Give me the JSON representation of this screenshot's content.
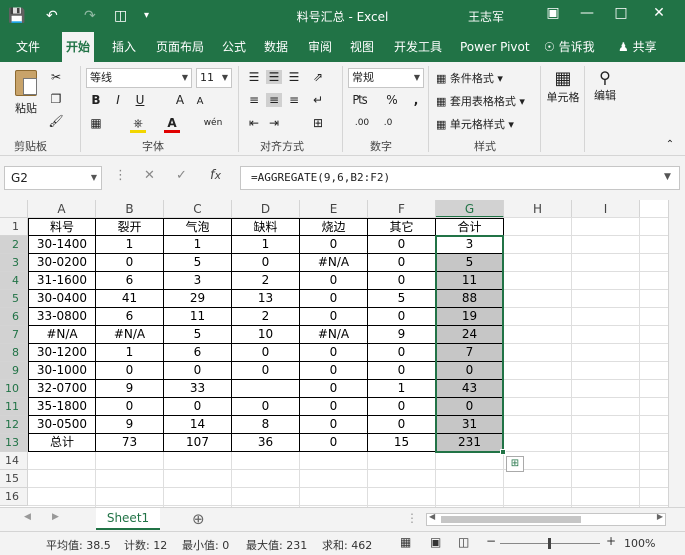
{
  "window": {
    "title": "料号汇总 - Excel",
    "user": "王志军"
  },
  "menu": {
    "tabs": [
      "文件",
      "开始",
      "插入",
      "页面布局",
      "公式",
      "数据",
      "审阅",
      "视图",
      "开发工具",
      "Power Pivot"
    ],
    "tell_me": "告诉我",
    "share": "共享"
  },
  "ribbon": {
    "clipboard": {
      "paste": "粘贴",
      "label": "剪贴板"
    },
    "font": {
      "name": "等线",
      "size": "11",
      "bold": "B",
      "italic": "I",
      "underline": "U",
      "grow": "A",
      "shrink": "A",
      "wen": "wén",
      "label": "字体"
    },
    "alignment": {
      "label": "对齐方式"
    },
    "number": {
      "format": "常规",
      "percent": "%",
      "comma": ",",
      "label": "数字"
    },
    "styles": {
      "conditional": "条件格式",
      "table": "套用表格格式",
      "cell": "单元格样式",
      "label": "样式"
    },
    "cells": {
      "label": "单元格"
    },
    "editing": {
      "label": "编辑"
    }
  },
  "formula_bar": {
    "name_box": "G2",
    "formula": "=AGGREGATE(9,6,B2:F2)"
  },
  "columns": [
    "A",
    "B",
    "C",
    "D",
    "E",
    "F",
    "G",
    "H",
    "I"
  ],
  "rows": [
    [
      "料号",
      "裂开",
      "气泡",
      "缺料",
      "烧边",
      "其它",
      "合计"
    ],
    [
      "30-1400",
      "1",
      "1",
      "1",
      "0",
      "0",
      "3"
    ],
    [
      "30-0200",
      "0",
      "5",
      "0",
      "#N/A",
      "0",
      "5"
    ],
    [
      "31-1600",
      "6",
      "3",
      "2",
      "0",
      "0",
      "11"
    ],
    [
      "30-0400",
      "41",
      "29",
      "13",
      "0",
      "5",
      "88"
    ],
    [
      "33-0800",
      "6",
      "11",
      "2",
      "0",
      "0",
      "19"
    ],
    [
      "#N/A",
      "#N/A",
      "5",
      "10",
      "#N/A",
      "9",
      "24"
    ],
    [
      "30-1200",
      "1",
      "6",
      "0",
      "0",
      "0",
      "7"
    ],
    [
      "30-1000",
      "0",
      "0",
      "0",
      "0",
      "0",
      "0"
    ],
    [
      "32-0700",
      "9",
      "33",
      "",
      "0",
      "1",
      "43"
    ],
    [
      "35-1800",
      "0",
      "0",
      "0",
      "0",
      "0",
      "0"
    ],
    [
      "30-0500",
      "9",
      "14",
      "8",
      "0",
      "0",
      "31"
    ],
    [
      "总计",
      "73",
      "107",
      "36",
      "0",
      "15",
      "231"
    ]
  ],
  "row_numbers": [
    "1",
    "2",
    "3",
    "4",
    "5",
    "6",
    "7",
    "8",
    "9",
    "10",
    "11",
    "12",
    "13",
    "14",
    "15",
    "16"
  ],
  "sheet": {
    "name": "Sheet1"
  },
  "status": {
    "average": "平均值: 38.5",
    "count": "计数: 12",
    "min": "最小值: 0",
    "max": "最大值: 231",
    "sum": "求和: 462",
    "zoom": "100%"
  },
  "colors": {
    "accent": "#217346",
    "selected_fill": "#c6c6c6"
  }
}
